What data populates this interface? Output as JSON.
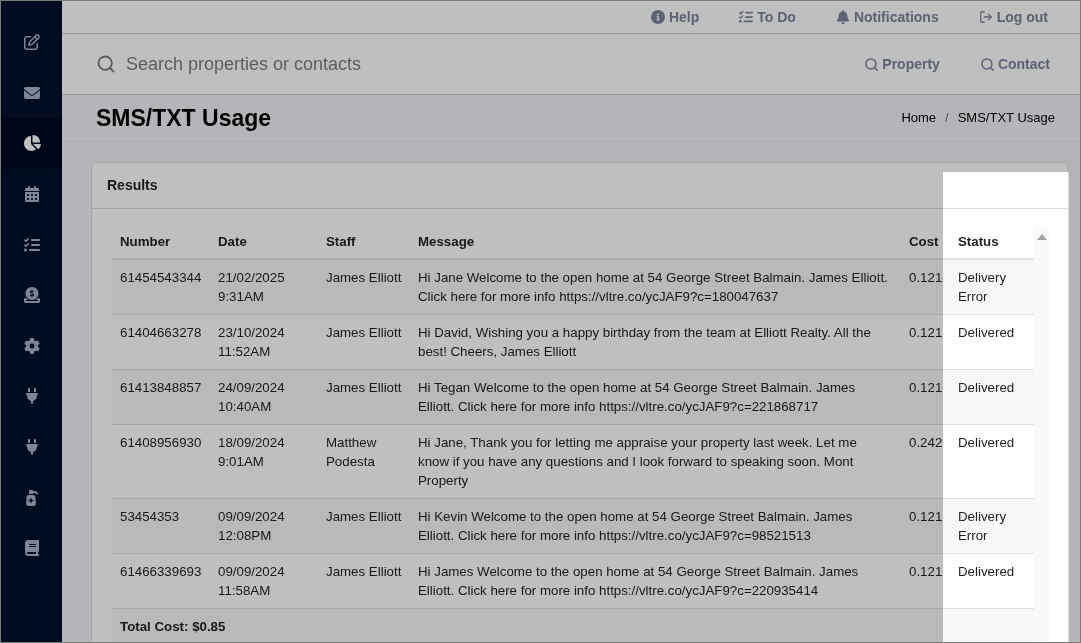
{
  "sidebar": {
    "items": [
      {
        "selected": false
      },
      {
        "selected": false
      },
      {
        "selected": true
      },
      {
        "selected": false
      },
      {
        "selected": false
      },
      {
        "selected": false
      },
      {
        "selected": false
      },
      {
        "selected": false
      },
      {
        "selected": false
      },
      {
        "selected": false
      },
      {
        "selected": false
      }
    ]
  },
  "top_nav": {
    "items": [
      {
        "label": "Help"
      },
      {
        "label": "To Do"
      },
      {
        "label": "Notifications"
      },
      {
        "label": "Log out"
      }
    ]
  },
  "search_bar": {
    "placeholder": "Search properties or contacts",
    "buttons": [
      {
        "label": "Property"
      },
      {
        "label": "Contact"
      }
    ]
  },
  "page_header": {
    "title": "SMS/TXT Usage",
    "breadcrumb": {
      "items": [
        "Home",
        "SMS/TXT Usage"
      ],
      "separator": "/"
    }
  },
  "results": {
    "title": "Results",
    "table": {
      "columns": [
        {
          "label": "Number",
          "highlighted": false
        },
        {
          "label": "Date",
          "highlighted": false
        },
        {
          "label": "Staff",
          "highlighted": false
        },
        {
          "label": "Message",
          "highlighted": false
        },
        {
          "label": "Cost",
          "highlighted": false
        },
        {
          "label": "Status",
          "highlighted": true
        }
      ],
      "rows": [
        {
          "number": "61454543344",
          "date": "21/02/2025 9:31AM",
          "staff": "James Elliott",
          "message": "Hi Jane Welcome to the open home at 54 George Street Balmain. James Elliott. Click here for more info https://vltre.co/ycJAF9?c=180047637",
          "cost": "0.121",
          "status": "Delivery Error"
        },
        {
          "number": "61404663278",
          "date": "23/10/2024 11:52AM",
          "staff": "James Elliott",
          "message": "Hi David, Wishing you a happy birthday from the team at Elliott Realty. All the best! Cheers, James Elliott",
          "cost": "0.121",
          "status": "Delivered"
        },
        {
          "number": "61413848857",
          "date": "24/09/2024 10:40AM",
          "staff": "James Elliott",
          "message": "Hi Tegan Welcome to the open home at 54 George Street Balmain. James Elliott. Click here for more info https://vltre.co/ycJAF9?c=221868717",
          "cost": "0.121",
          "status": "Delivered"
        },
        {
          "number": "61408956930",
          "date": "18/09/2024 9:01AM",
          "staff": "Matthew Podesta",
          "message": "Hi Jane, Thank you for letting me appraise your property last week. Let me know if you have any questions and I look forward to speaking soon. Mont Property",
          "cost": "0.242",
          "status": "Delivered"
        },
        {
          "number": "53454353",
          "date": "09/09/2024 12:08PM",
          "staff": "James Elliott",
          "message": "Hi Kevin Welcome to the open home at 54 George Street Balmain. James Elliott. Click here for more info https://vltre.co/ycJAF9?c=98521513",
          "cost": "0.121",
          "status": "Delivery Error"
        },
        {
          "number": "61466339693",
          "date": "09/09/2024 11:58AM",
          "staff": "James Elliott",
          "message": "Hi James Welcome to the open home at 54 George Street Balmain. James Elliott. Click here for more info https://vltre.co/ycJAF9?c=220935414",
          "cost": "0.121",
          "status": "Delivered"
        }
      ],
      "total": "Total Cost: $0.85"
    }
  }
}
